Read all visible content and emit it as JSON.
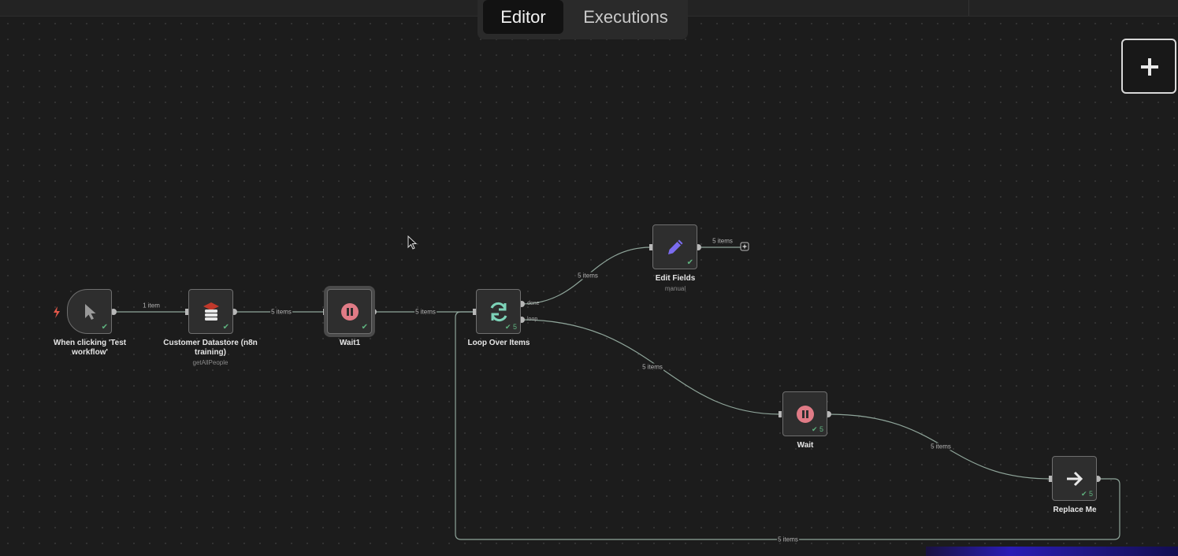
{
  "tabs": {
    "editor": "Editor",
    "executions": "Executions"
  },
  "nodes": {
    "trigger": {
      "label": "When clicking 'Test workflow'",
      "icon": "cursor-icon"
    },
    "datastore": {
      "label": "Customer Datastore (n8n training)",
      "sub": "getAllPeople",
      "icon": "database-icon"
    },
    "wait1": {
      "label": "Wait1",
      "icon": "pause-icon"
    },
    "loop": {
      "label": "Loop Over Items",
      "count": "5",
      "icon": "refresh-icon"
    },
    "edit": {
      "label": "Edit Fields",
      "sub": "manual",
      "icon": "pencil-icon"
    },
    "wait": {
      "label": "Wait",
      "count": "5",
      "icon": "pause-icon"
    },
    "replace": {
      "label": "Replace Me",
      "count": "5",
      "icon": "arrow-right-icon"
    }
  },
  "ports": {
    "done": "done",
    "loop": "loop"
  },
  "edges": {
    "e1": "1 item",
    "e2": "5 items",
    "e3": "5 items",
    "e4": "5 items",
    "e5": "5 items",
    "e6": "5 items",
    "e7": "5 items",
    "e8": "5 items"
  },
  "colors": {
    "success": "#5fb37f",
    "wait": "#e07b86",
    "loop": "#7dd3b8",
    "edit": "#7b6cf0",
    "edge": "#8fa59a"
  }
}
